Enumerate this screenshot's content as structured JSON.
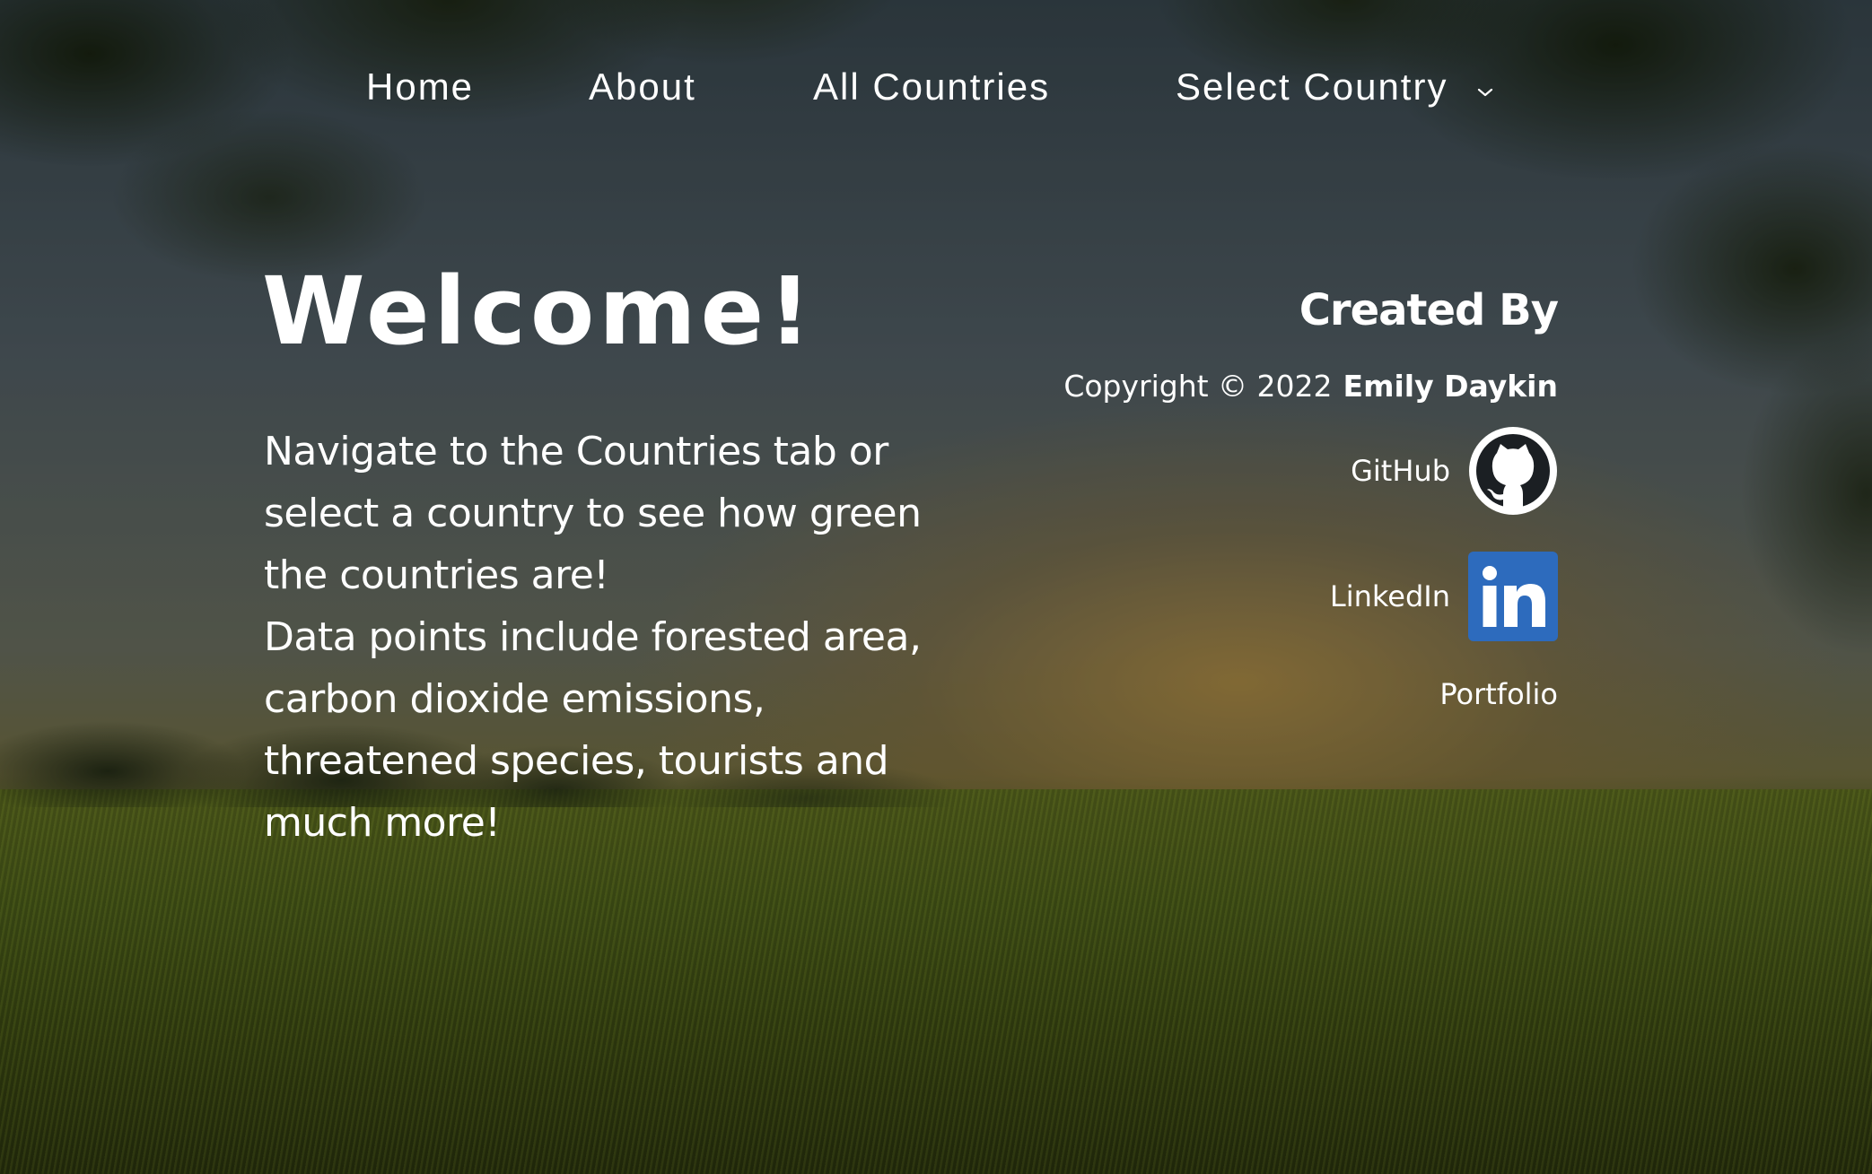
{
  "nav": {
    "items": [
      {
        "label": "Home"
      },
      {
        "label": "About"
      },
      {
        "label": "All Countries"
      },
      {
        "label": "Select Country"
      }
    ]
  },
  "welcome": {
    "title": "Welcome!",
    "paragraph1": "Navigate to the Countries tab or select a country to see how green the countries are!",
    "paragraph2": "Data points include forested area, carbon dioxide emissions, threatened species, tourists and much more!"
  },
  "credits": {
    "heading": "Created By",
    "copyright": "Copyright © 2022",
    "author": "Emily Daykin",
    "links": [
      {
        "label": "GitHub",
        "icon": "github-icon"
      },
      {
        "label": "LinkedIn",
        "icon": "linkedin-icon"
      },
      {
        "label": "Portfolio"
      }
    ]
  },
  "colors": {
    "text": "#ffffff",
    "linkedin_blue": "#2d6bbd",
    "github_dark": "#1b1f23"
  }
}
